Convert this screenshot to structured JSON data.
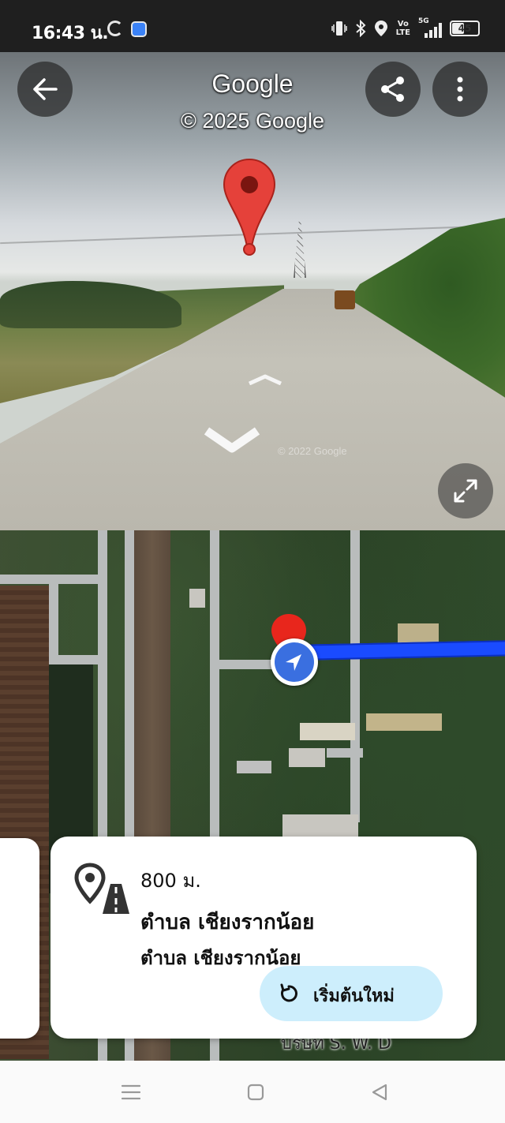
{
  "status_bar": {
    "time": "16:43 น.",
    "icons": [
      "google-icon",
      "app-icon",
      "vibrate-icon",
      "bluetooth-icon",
      "location-icon",
      "volte-icon",
      "signal-5g-icon",
      "battery-icon"
    ],
    "volte_text": "Vo\nLTE",
    "network_text": "5G",
    "battery_level": "45"
  },
  "street_view": {
    "header_title": "Google",
    "copyright": "© 2025 Google",
    "watermark": "© 2022 Google",
    "pin_color": "#e5413a"
  },
  "map": {
    "route_color": "#1a4bff",
    "label_partial": "บริษัท S. W. D"
  },
  "card": {
    "distance": "800 ม.",
    "title": "ตำบล เชียงรากน้อย",
    "subtitle": "ตำบล เชียงรากน้อย",
    "restart_button": "เริ่มต้นใหม่",
    "restart_button_color": "#cdeefc"
  },
  "nav_bar": {
    "buttons": [
      "menu-icon",
      "home-icon",
      "back-icon"
    ]
  }
}
